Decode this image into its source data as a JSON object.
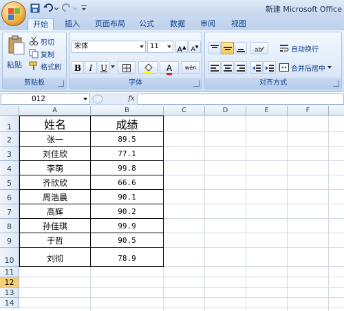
{
  "window": {
    "title": "新建 Microsoft Office"
  },
  "tabs": [
    "开始",
    "插入",
    "页面布局",
    "公式",
    "数据",
    "审阅",
    "视图"
  ],
  "clipboard": {
    "paste": "粘贴",
    "cut": "剪切",
    "copy": "复制",
    "format_painter": "格式刷",
    "label": "剪贴板"
  },
  "font": {
    "name": "宋体",
    "size": "11",
    "label": "字体",
    "bold": "B",
    "italic": "I",
    "underline": "U",
    "wen": "wén"
  },
  "alignment": {
    "wrap": "自动换行",
    "merge": "合并后居中",
    "label": "对齐方式"
  },
  "formula_bar": {
    "name_box": "O12",
    "fx": "fx"
  },
  "columns": [
    "A",
    "B",
    "C",
    "D",
    "E",
    "F"
  ],
  "rows": [
    "1",
    "2",
    "3",
    "4",
    "5",
    "6",
    "7",
    "8",
    "9",
    "10",
    "11",
    "12",
    "13",
    "14"
  ],
  "table": {
    "headers": [
      "姓名",
      "成绩"
    ],
    "rows": [
      [
        "张一",
        "89.5"
      ],
      [
        "刘佳欣",
        "77.1"
      ],
      [
        "李萌",
        "99.8"
      ],
      [
        "齐欣欣",
        "66.6"
      ],
      [
        "周浩晨",
        "90.1"
      ],
      [
        "高辉",
        "90.2"
      ],
      [
        "孙佳琪",
        "99.9"
      ],
      [
        "于哲",
        "90.5"
      ],
      [
        "刘彻",
        "78.9"
      ]
    ]
  },
  "colors": {
    "accent": "#15428b",
    "ribbon": "#dbe7f7",
    "selected_button": "#f8c657"
  }
}
